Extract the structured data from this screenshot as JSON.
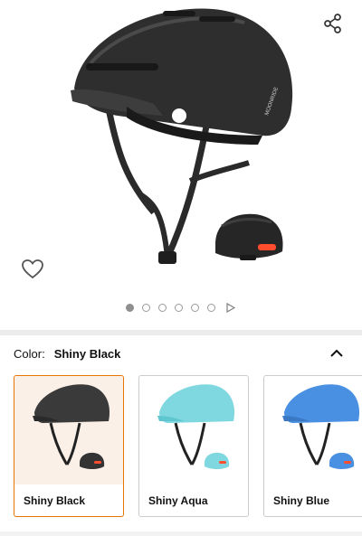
{
  "product": {
    "main_color": "#2b2b2b",
    "accent_color": "#e77600"
  },
  "gallery": {
    "image_count": 6,
    "active_index": 0
  },
  "color_selector": {
    "label": "Color:",
    "selected_value": "Shiny Black",
    "swatches": [
      {
        "name": "Shiny Black",
        "color": "#3a3a3a",
        "selected": true
      },
      {
        "name": "Shiny Aqua",
        "color": "#7fd8e0",
        "selected": false
      },
      {
        "name": "Shiny Blue",
        "color": "#4a90e2",
        "selected": false
      }
    ]
  },
  "icons": {
    "share": "share-icon",
    "favorite": "heart-icon",
    "collapse": "chevron-up-icon",
    "video": "play-icon"
  }
}
